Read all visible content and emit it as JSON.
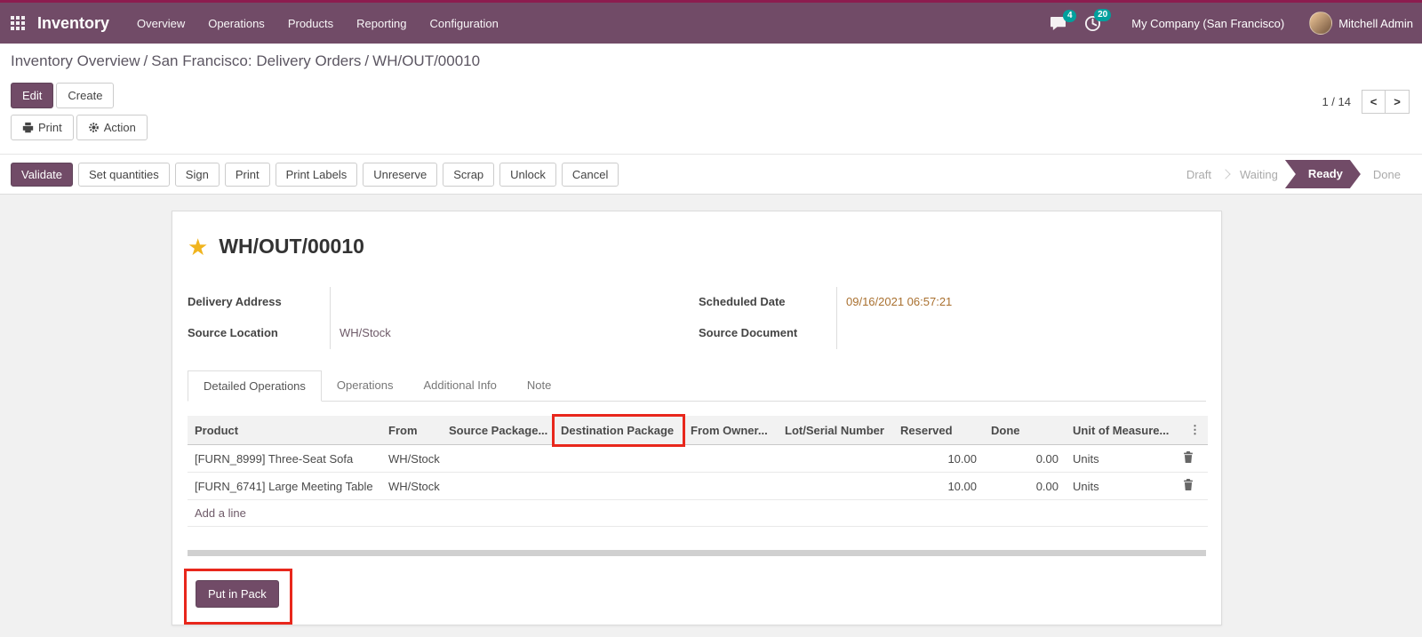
{
  "navbar": {
    "app_name": "Inventory",
    "menus": [
      "Overview",
      "Operations",
      "Products",
      "Reporting",
      "Configuration"
    ],
    "messages_badge": "4",
    "activities_badge": "20",
    "company": "My Company (San Francisco)",
    "user": "Mitchell Admin"
  },
  "breadcrumb": {
    "part1": "Inventory Overview",
    "part2": "San Francisco: Delivery Orders",
    "part3": "WH/OUT/00010",
    "separator": "/"
  },
  "control_panel": {
    "edit": "Edit",
    "create": "Create",
    "print": "Print",
    "action": "Action",
    "pager_count": "1 / 14",
    "pager_prev": "<",
    "pager_next": ">"
  },
  "statusbar": {
    "buttons": [
      "Validate",
      "Set quantities",
      "Sign",
      "Print",
      "Print Labels",
      "Unreserve",
      "Scrap",
      "Unlock",
      "Cancel"
    ],
    "stages": [
      "Draft",
      "Waiting",
      "Ready",
      "Done"
    ],
    "active_stage": "Ready"
  },
  "form": {
    "title": "WH/OUT/00010",
    "star_icon": "★",
    "fields": {
      "delivery_address_label": "Delivery Address",
      "source_location_label": "Source Location",
      "source_location_value": "WH/Stock",
      "scheduled_date_label": "Scheduled Date",
      "scheduled_date_value": "09/16/2021 06:57:21",
      "source_document_label": "Source Document"
    },
    "tabs": [
      "Detailed Operations",
      "Operations",
      "Additional Info",
      "Note"
    ],
    "active_tab": "Detailed Operations",
    "table": {
      "headers": [
        "Product",
        "From",
        "Source Package...",
        "Destination Package",
        "From Owner...",
        "Lot/Serial Number",
        "Reserved",
        "Done",
        "Unit of Measure..."
      ],
      "options_icon": "⋮",
      "rows": [
        {
          "product": "[FURN_8999] Three-Seat Sofa",
          "from": "WH/Stock",
          "source_package": "",
          "destination_package": "",
          "from_owner": "",
          "lot_serial": "",
          "reserved": "10.00",
          "done": "0.00",
          "uom": "Units"
        },
        {
          "product": "[FURN_6741] Large Meeting Table",
          "from": "WH/Stock",
          "source_package": "",
          "destination_package": "",
          "from_owner": "",
          "lot_serial": "",
          "reserved": "10.00",
          "done": "0.00",
          "uom": "Units"
        }
      ],
      "add_line": "Add a line"
    },
    "put_in_pack": "Put in Pack"
  },
  "colors": {
    "primary": "#714B67",
    "topstrip": "#8c1c4f",
    "badge": "#00a09d",
    "highlight_red": "#e8271c",
    "date_text": "#a9702f",
    "star": "#f0b41e"
  }
}
